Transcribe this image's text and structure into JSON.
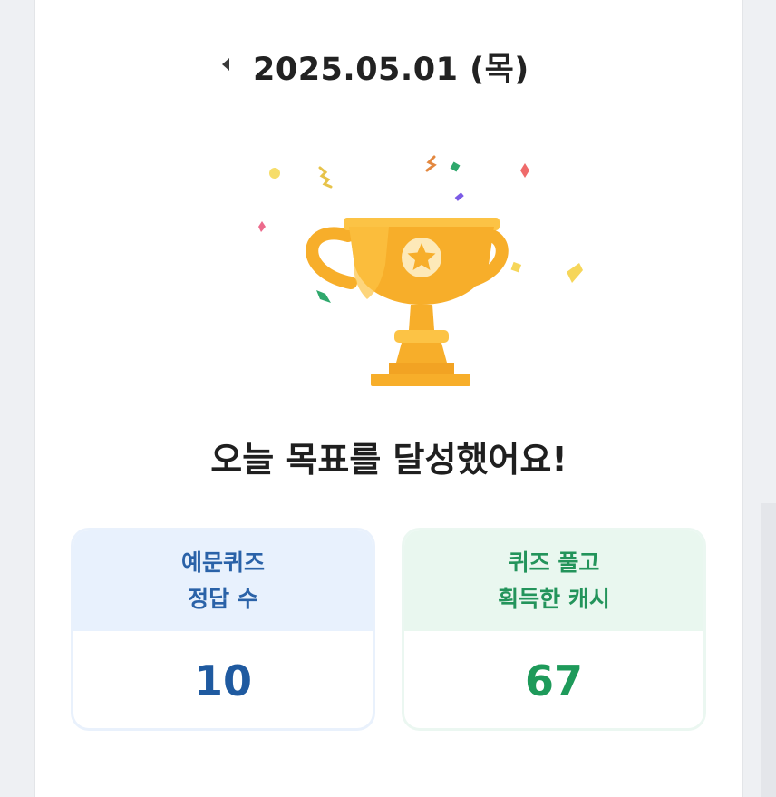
{
  "header": {
    "date": "2025.05.01 (목)",
    "prev_icon": "caret-left-icon"
  },
  "illustration": {
    "icon": "trophy-icon",
    "emblem": "star-icon",
    "decoration": "confetti"
  },
  "headline": "오늘 목표를 달성했어요!",
  "stats": {
    "quiz_correct": {
      "label_line1": "예문퀴즈",
      "label_line2": "정답 수",
      "value": "10"
    },
    "cash_earned": {
      "label_line1": "퀴즈 풀고",
      "label_line2": "획득한 캐시",
      "value": "67"
    }
  },
  "colors": {
    "trophy_gold": "#f7ae2a",
    "trophy_light": "#fcc345",
    "blue_accent": "#2a62a8",
    "green_accent": "#23945b",
    "text_dark": "#222222"
  }
}
